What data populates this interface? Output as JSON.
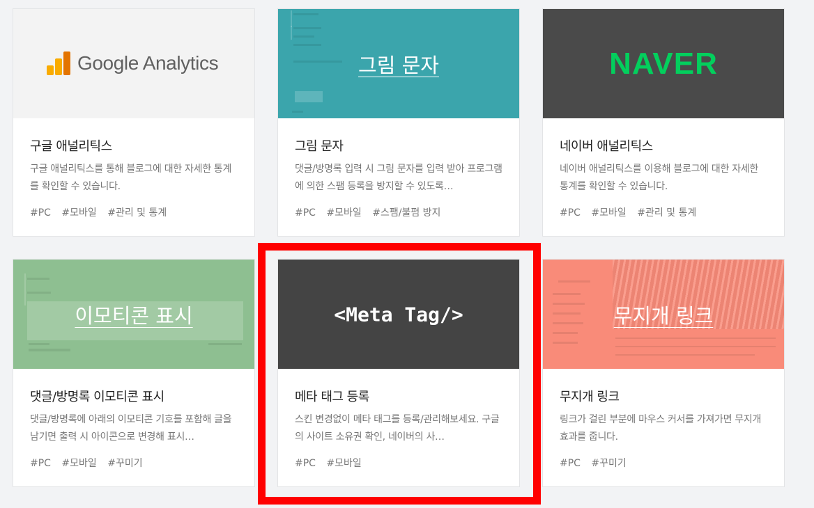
{
  "cards": [
    {
      "title": "구글 애널리틱스",
      "desc": "구글 애널리틱스를 통해 블로그에 대한 자세한 통계를 확인할 수 있습니다.",
      "tags": [
        "#PC",
        "#모바일",
        "#관리 및 통계"
      ],
      "thumb_text": "Google Analytics",
      "thumb_color": "#f3f3f3"
    },
    {
      "title": "그림 문자",
      "desc": "댓글/방명록 입력 시 그림 문자를 입력 받아 프로그램에 의한 스팸 등록을 방지할 수 있도록…",
      "tags": [
        "#PC",
        "#모바일",
        "#스팸/불펌 방지"
      ],
      "thumb_text": "그림 문자",
      "thumb_color": "#3ba5ac"
    },
    {
      "title": "네이버 애널리틱스",
      "desc": "네이버 애널리틱스를 이용해 블로그에 대한 자세한 통계를 확인할 수 있습니다.",
      "tags": [
        "#PC",
        "#모바일",
        "#관리 및 통계"
      ],
      "thumb_text": "NAVER",
      "thumb_color": "#4a4a4a"
    },
    {
      "title": "댓글/방명록 이모티콘 표시",
      "desc": "댓글/방명록에 아래의 이모티콘 기호를 포함해 글을 남기면 출력 시 아이콘으로 변경해 표시…",
      "tags": [
        "#PC",
        "#모바일",
        "#꾸미기"
      ],
      "thumb_text": "이모티콘 표시",
      "thumb_color": "#8ebf91"
    },
    {
      "title": "메타 태그 등록",
      "desc": "스킨 변경없이 메타 태그를 등록/관리해보세요. 구글의 사이트 소유권 확인, 네이버의 사…",
      "tags": [
        "#PC",
        "#모바일"
      ],
      "thumb_text": "<Meta Tag/>",
      "thumb_color": "#444444"
    },
    {
      "title": "무지개 링크",
      "desc": "링크가 걸린 부분에 마우스 커서를 가져가면 무지개 효과를 줍니다.",
      "tags": [
        "#PC",
        "#꾸미기"
      ],
      "thumb_text": "무지개 링크",
      "thumb_color": "#f98b79"
    }
  ],
  "colors": {
    "highlight": "#ff0000",
    "naver_green": "#03cf5d"
  }
}
